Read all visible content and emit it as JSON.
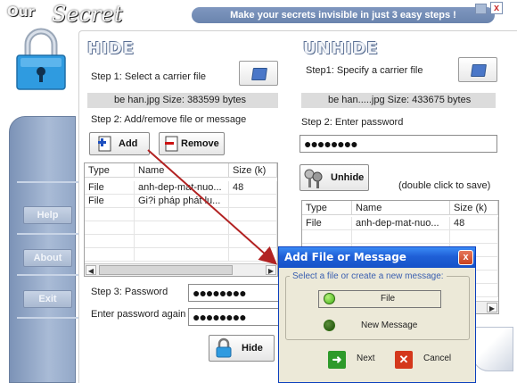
{
  "app": {
    "logo_our": "Our",
    "logo_secret": "Secret",
    "tagline": "Make your secrets invisible in just 3 easy steps !",
    "close_glyph": "x"
  },
  "sidebar": {
    "items": [
      {
        "label": "Help"
      },
      {
        "label": "About"
      },
      {
        "label": "Exit"
      }
    ]
  },
  "hide": {
    "title": "HIDE",
    "step1": "Step 1: Select a carrier file",
    "carrier_info": "be han.jpg   Size: 383599 bytes",
    "step2": "Step 2: Add/remove file or message",
    "add_label": "Add",
    "remove_label": "Remove",
    "table": {
      "headers": [
        "Type",
        "Name",
        "Size (k)"
      ],
      "rows": [
        [
          "File",
          "anh-dep-mat-nuo...",
          "48"
        ],
        [
          "File",
          "Gi?i pháp phát lu...",
          ""
        ]
      ]
    },
    "step3": "Step 3: Password",
    "password_value": "●●●●●●●●",
    "enter_again": "Enter password again",
    "password_again_value": "●●●●●●●●",
    "hide_label": "Hide"
  },
  "unhide": {
    "title": "UNHIDE",
    "step1": "Step1: Specify a carrier file",
    "carrier_info": "be han.....jpg   Size: 433675 bytes",
    "step2": "Step 2: Enter password",
    "password_value": "●●●●●●●●",
    "unhide_label": "Unhide",
    "hint": "(double click to save)",
    "table": {
      "headers": [
        "Type",
        "Name",
        "Size (k)"
      ],
      "rows": [
        [
          "File",
          "anh-dep-mat-nuo...",
          "48"
        ]
      ]
    }
  },
  "dialog": {
    "title": "Add File or Message",
    "group_label": "Select a file or create a new message:",
    "option_file": "File",
    "option_message": "New Message",
    "next_label": "Next",
    "cancel_label": "Cancel",
    "selected": "File"
  },
  "colors": {
    "accent": "#6a84ae",
    "dialog_title": "#1f5fd6",
    "arrow": "#b22222"
  }
}
